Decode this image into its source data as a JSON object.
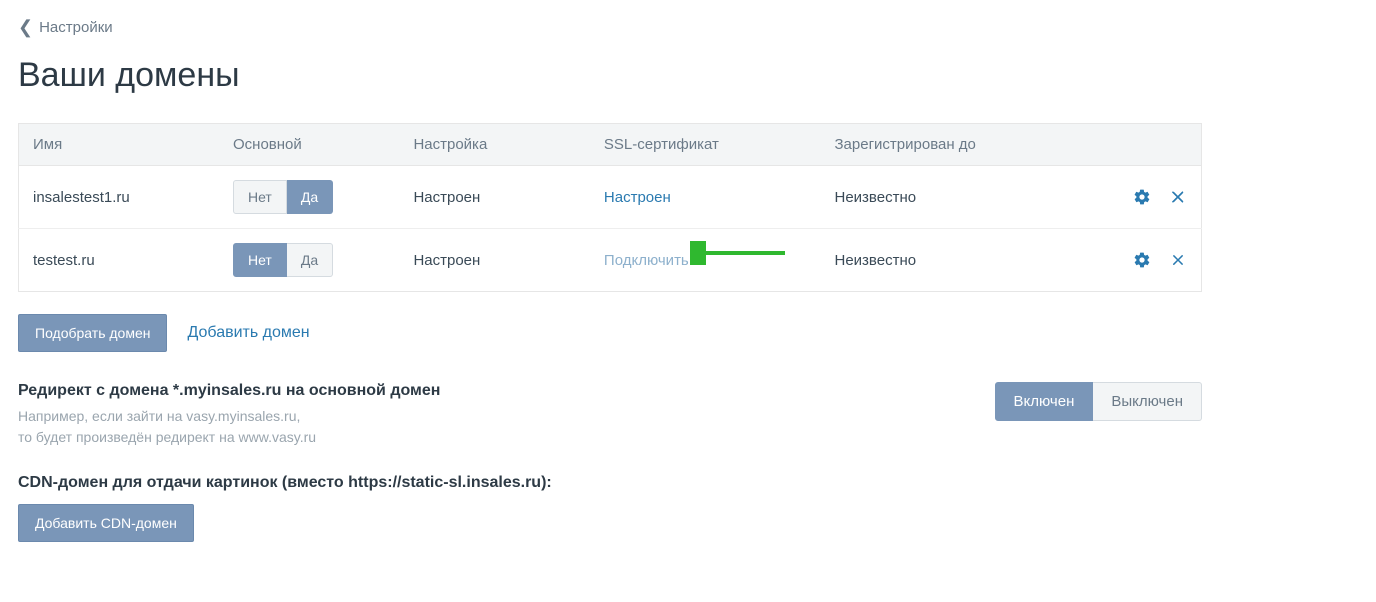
{
  "breadcrumb": {
    "label": "Настройки"
  },
  "page_title": "Ваши домены",
  "table": {
    "headers": {
      "name": "Имя",
      "main": "Основной",
      "setup": "Настройка",
      "ssl": "SSL-сертификат",
      "registered": "Зарегистрирован до"
    },
    "toggle": {
      "no": "Нет",
      "yes": "Да"
    },
    "rows": [
      {
        "name": "insalestest1.ru",
        "main_active": "yes",
        "setup": "Настроен",
        "ssl_label": "Настроен",
        "ssl_style": "link",
        "registered": "Неизвестно"
      },
      {
        "name": "testest.ru",
        "main_active": "no",
        "setup": "Настроен",
        "ssl_label": "Подключить",
        "ssl_style": "link-muted",
        "registered": "Неизвестно"
      }
    ]
  },
  "actions": {
    "pick_domain": "Подобрать домен",
    "add_domain": "Добавить домен"
  },
  "redirect": {
    "label": "Редирект с домена *.myinsales.ru на основной домен",
    "help1": "Например, если зайти на vasy.myinsales.ru,",
    "help2": "то будет произведён редирект на www.vasy.ru",
    "on": "Включен",
    "off": "Выключен",
    "active": "on"
  },
  "cdn": {
    "label": "CDN-домен для отдачи картинок (вместо https://static-sl.insales.ru):",
    "add_button": "Добавить CDN-домен"
  },
  "colors": {
    "primary": "#7a96b8",
    "link": "#2a7ab0",
    "icon_blue": "#2a7ab0",
    "arrow": "#2fb82f"
  }
}
